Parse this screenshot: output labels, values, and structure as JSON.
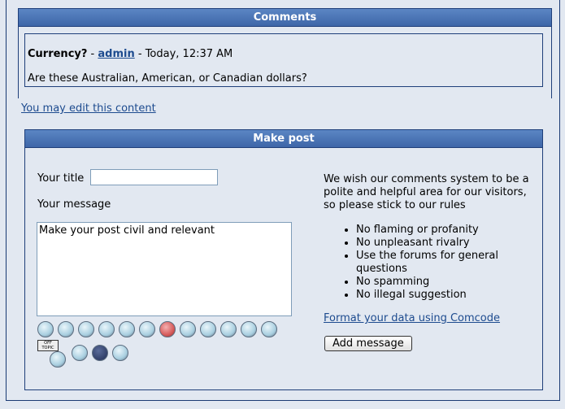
{
  "comments": {
    "title": "Comments",
    "post": {
      "title": "Currency?",
      "sep": " - ",
      "author": "admin",
      "time": " - Today, 12:37 AM",
      "body": "Are these Australian, American, or Canadian dollars?"
    }
  },
  "edit_link": "You may edit this content",
  "make_post": {
    "title": "Make post",
    "title_label": "Your title",
    "title_value": "",
    "message_label": "Your message",
    "message_value": "Make your post civil and relevant",
    "emoticons": [
      "tongue",
      "cry",
      "wink",
      "blush",
      "smile",
      "neutral",
      "love",
      "cool",
      "grin",
      "sad",
      "glad",
      "thumbs",
      "offtopic",
      "plain",
      "dark-grin",
      "shocked"
    ],
    "rules_intro": "We wish our comments system to be a polite and helpful area for our visitors, so please stick to our rules",
    "rules": [
      "No flaming or profanity",
      "No unpleasant rivalry",
      "Use the forums for general questions",
      "No spamming",
      "No illegal suggestion"
    ],
    "comcode_link": "Format your data using Comcode",
    "submit": "Add message"
  }
}
